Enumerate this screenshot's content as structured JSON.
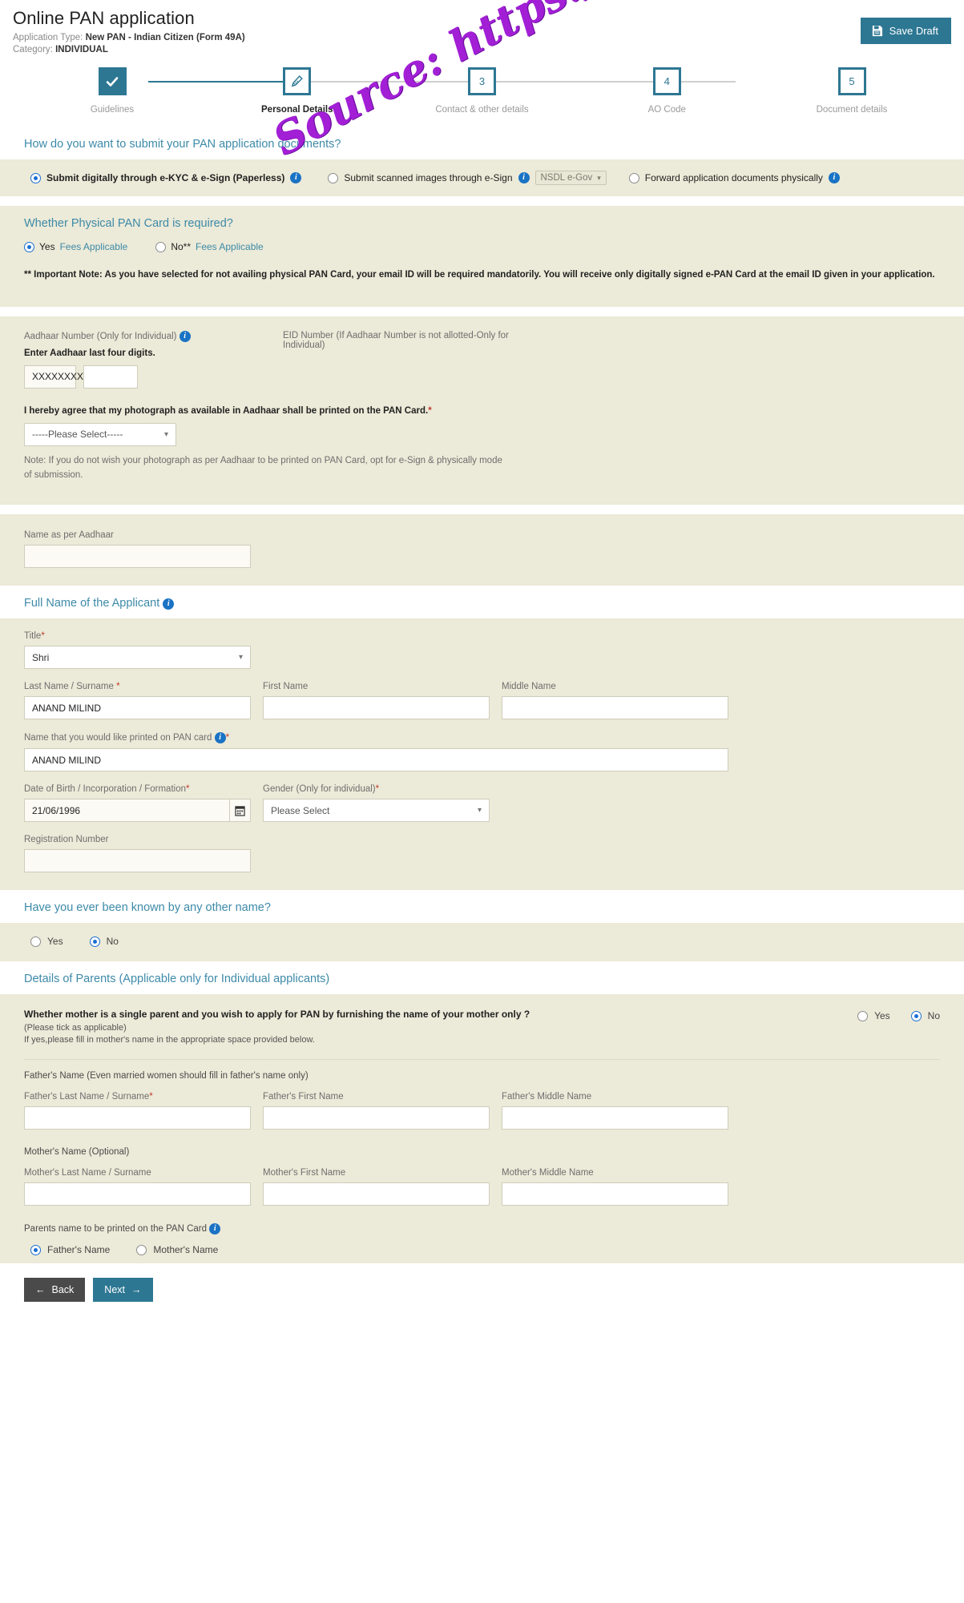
{
  "header": {
    "title": "Online PAN application",
    "application_type_label": "Application Type:",
    "application_type_value": "New PAN - Indian Citizen (Form 49A)",
    "category_label": "Category:",
    "category_value": "INDIVIDUAL",
    "save_draft_label": "Save Draft"
  },
  "stepper": {
    "steps": [
      {
        "num": "✔",
        "label": "Guidelines",
        "state": "done"
      },
      {
        "num": "✎",
        "label": "Personal Details",
        "state": "current"
      },
      {
        "num": "3",
        "label": "Contact & other details",
        "state": "todo"
      },
      {
        "num": "4",
        "label": "AO Code",
        "state": "todo"
      },
      {
        "num": "5",
        "label": "Document details",
        "state": "todo"
      }
    ]
  },
  "submission": {
    "title": "How do you want to submit your PAN application documents?",
    "option1": "Submit digitally through e-KYC & e-Sign (Paperless)",
    "option2": "Submit scanned images through e-Sign",
    "option2_select": "NSDL e-Gov",
    "option3": "Forward application documents physically"
  },
  "physical_card": {
    "title": "Whether Physical PAN Card is required?",
    "yes_label": "Yes",
    "yes_link": "Fees Applicable",
    "no_label": "No**",
    "no_link": "Fees Applicable",
    "note_bold": "** Important Note: As you have selected for not availing physical PAN Card, your email ID will be required mandatorily. You will receive only digitally signed e-PAN Card at the email ID given in your application."
  },
  "aadhaar": {
    "number_label": "Aadhaar Number (Only for Individual)",
    "enter_last_four": "Enter Aadhaar last four digits.",
    "masked_value": "XXXXXXXX",
    "last_four_value": "",
    "eid_label": "EID Number (If Aadhaar Number is not allotted-Only for Individual)",
    "consent_label": "I hereby agree that my photograph as available in Aadhaar shall be printed on the PAN Card.",
    "consent_select": "-----Please Select-----",
    "consent_note": "Note: If you do not wish your photograph as per Aadhaar to be printed on PAN Card, opt for e-Sign & physically mode of submission."
  },
  "name_as_aadhaar": {
    "label": "Name as per Aadhaar",
    "value": ""
  },
  "full_name": {
    "section_title": "Full Name of the Applicant",
    "title_label": "Title",
    "title_value": "Shri",
    "last_name_label": "Last Name / Surname",
    "last_name_value": "ANAND MILIND",
    "first_name_label": "First Name",
    "first_name_value": "",
    "middle_name_label": "Middle Name",
    "middle_name_value": "",
    "printed_name_label": "Name that you would like printed on PAN card",
    "printed_name_value": "ANAND MILIND",
    "dob_label": "Date of Birth / Incorporation / Formation",
    "dob_value": "21/06/1996",
    "gender_label": "Gender (Only for individual)",
    "gender_value": "Please Select",
    "reg_label": "Registration Number",
    "reg_value": ""
  },
  "other_name": {
    "title": "Have you ever been known by any other name?",
    "yes": "Yes",
    "no": "No"
  },
  "parents": {
    "section_title": "Details of Parents (Applicable only for Individual applicants)",
    "single_parent_q": "Whether mother is a single parent and you wish to apply for PAN by furnishing the name of your mother only ?",
    "single_parent_sub1": "(Please tick as applicable)",
    "single_parent_sub2": "If yes,please fill in mother's name in the appropriate space provided below.",
    "yes": "Yes",
    "no": "No",
    "father_heading": "Father's Name (Even married women should fill in father's name only)",
    "father_last_label": "Father's Last Name / Surname",
    "father_last_value": "",
    "father_first_label": "Father's First Name",
    "father_first_value": "",
    "father_middle_label": "Father's Middle Name",
    "father_middle_value": "",
    "mother_heading": "Mother's Name (Optional)",
    "mother_last_label": "Mother's Last Name / Surname",
    "mother_last_value": "",
    "mother_first_label": "Mother's First Name",
    "mother_first_value": "",
    "mother_middle_label": "Mother's Middle Name",
    "mother_middle_value": "",
    "printed_parent_label": "Parents name to be printed on the PAN Card",
    "father_opt": "Father's Name",
    "mother_opt": "Mother's Name"
  },
  "footer": {
    "back": "Back",
    "next": "Next"
  },
  "watermark": "Source: https://www.onlineservices.nsdl.com/",
  "colors": {
    "accent": "#2d7793",
    "panel": "#ecead8",
    "link": "#3d8aa8",
    "watermark": "#a21fd6"
  }
}
